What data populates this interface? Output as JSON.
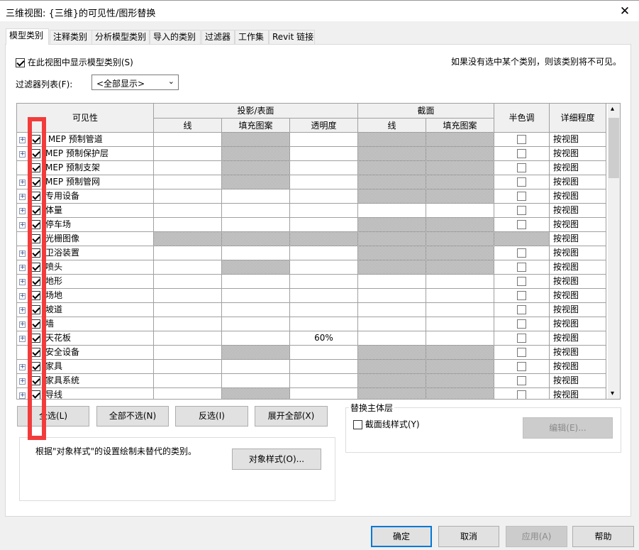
{
  "window": {
    "title": "三维视图: {三维}的可见性/图形替换",
    "close_icon": "close-icon"
  },
  "tabs": [
    "模型类别",
    "注释类别",
    "分析模型类别",
    "导入的类别",
    "过滤器",
    "工作集",
    "Revit 链接"
  ],
  "show_model_categories": {
    "label": "在此视图中显示模型类别(S)",
    "checked": true
  },
  "hint": "如果没有选中某个类别，则该类别将不可见。",
  "filter_list": {
    "label": "过滤器列表(F):",
    "value": "<全部显示>"
  },
  "table": {
    "headers": {
      "visibility": "可见性",
      "projection": "投影/表面",
      "section": "截面",
      "halftone": "半色调",
      "detail": "详细程度",
      "line": "线",
      "fill": "填充图案",
      "transparency": "透明度",
      "sec_line": "线",
      "sec_fill": "填充图案"
    },
    "rows": [
      {
        "name": " MEP 预制管道",
        "expand": true,
        "checked": true,
        "pfill_na": true,
        "sec_na": true,
        "all_na": false,
        "transparency": "",
        "detail": "按视图"
      },
      {
        "name": "MEP 预制保护层",
        "expand": true,
        "checked": true,
        "pfill_na": true,
        "sec_na": true,
        "all_na": false,
        "transparency": "",
        "detail": "按视图"
      },
      {
        "name": "MEP 预制支架",
        "expand": false,
        "checked": true,
        "pfill_na": true,
        "sec_na": true,
        "all_na": false,
        "transparency": "",
        "detail": "按视图"
      },
      {
        "name": "MEP 预制管网",
        "expand": true,
        "checked": true,
        "pfill_na": true,
        "sec_na": true,
        "all_na": false,
        "transparency": "",
        "detail": "按视图"
      },
      {
        "name": "专用设备",
        "expand": true,
        "checked": true,
        "pfill_na": false,
        "sec_na": true,
        "all_na": false,
        "transparency": "",
        "detail": "按视图"
      },
      {
        "name": "体量",
        "expand": true,
        "checked": true,
        "pfill_na": false,
        "sec_na": false,
        "all_na": false,
        "transparency": "",
        "detail": "按视图"
      },
      {
        "name": "停车场",
        "expand": true,
        "checked": true,
        "pfill_na": false,
        "sec_na": true,
        "all_na": false,
        "transparency": "",
        "detail": "按视图"
      },
      {
        "name": "光栅图像",
        "expand": false,
        "checked": true,
        "pfill_na": true,
        "sec_na": true,
        "all_na": true,
        "transparency": "",
        "detail": "按视图"
      },
      {
        "name": "卫浴装置",
        "expand": true,
        "checked": true,
        "pfill_na": false,
        "sec_na": true,
        "all_na": false,
        "transparency": "",
        "detail": "按视图"
      },
      {
        "name": "喷头",
        "expand": true,
        "checked": true,
        "pfill_na": true,
        "sec_na": true,
        "all_na": false,
        "transparency": "",
        "detail": "按视图"
      },
      {
        "name": "地形",
        "expand": true,
        "checked": true,
        "pfill_na": false,
        "sec_na": false,
        "all_na": false,
        "transparency": "",
        "detail": "按视图"
      },
      {
        "name": "场地",
        "expand": true,
        "checked": true,
        "pfill_na": false,
        "sec_na": false,
        "all_na": false,
        "transparency": "",
        "detail": "按视图"
      },
      {
        "name": "坡道",
        "expand": true,
        "checked": true,
        "pfill_na": false,
        "sec_na": false,
        "all_na": false,
        "transparency": "",
        "detail": "按视图"
      },
      {
        "name": "墙",
        "expand": true,
        "checked": true,
        "pfill_na": false,
        "sec_na": false,
        "all_na": false,
        "transparency": "",
        "detail": "按视图"
      },
      {
        "name": "天花板",
        "expand": true,
        "checked": true,
        "pfill_na": false,
        "sec_na": false,
        "all_na": false,
        "transparency": "60%",
        "detail": "按视图"
      },
      {
        "name": "安全设备",
        "expand": false,
        "checked": true,
        "pfill_na": true,
        "sec_na": true,
        "all_na": false,
        "transparency": "",
        "detail": "按视图"
      },
      {
        "name": "家具",
        "expand": true,
        "checked": true,
        "pfill_na": false,
        "sec_na": true,
        "all_na": false,
        "transparency": "",
        "detail": "按视图"
      },
      {
        "name": "家具系统",
        "expand": true,
        "checked": true,
        "pfill_na": false,
        "sec_na": true,
        "all_na": false,
        "transparency": "",
        "detail": "按视图"
      },
      {
        "name": "导线",
        "expand": true,
        "checked": true,
        "pfill_na": true,
        "sec_na": true,
        "all_na": false,
        "transparency": "",
        "detail": "按视图"
      }
    ]
  },
  "buttons": {
    "select_all": "全选(L)",
    "select_none": "全部不选(N)",
    "invert": "反选(I)",
    "expand_all": "展开全部(X)",
    "object_styles": "对象样式(O)...",
    "edit": "编辑(E)...",
    "ok": "确定",
    "cancel": "取消",
    "apply": "应用(A)",
    "help": "帮助"
  },
  "object_styles_note": "根据\"对象样式\"的设置绘制未替代的类别。",
  "host_layer": {
    "title": "替换主体层",
    "cut_line_styles": "截面线样式(Y)",
    "checked": false
  },
  "colors": {
    "accent": "#0078d7",
    "annotation": "#f23c3c"
  }
}
